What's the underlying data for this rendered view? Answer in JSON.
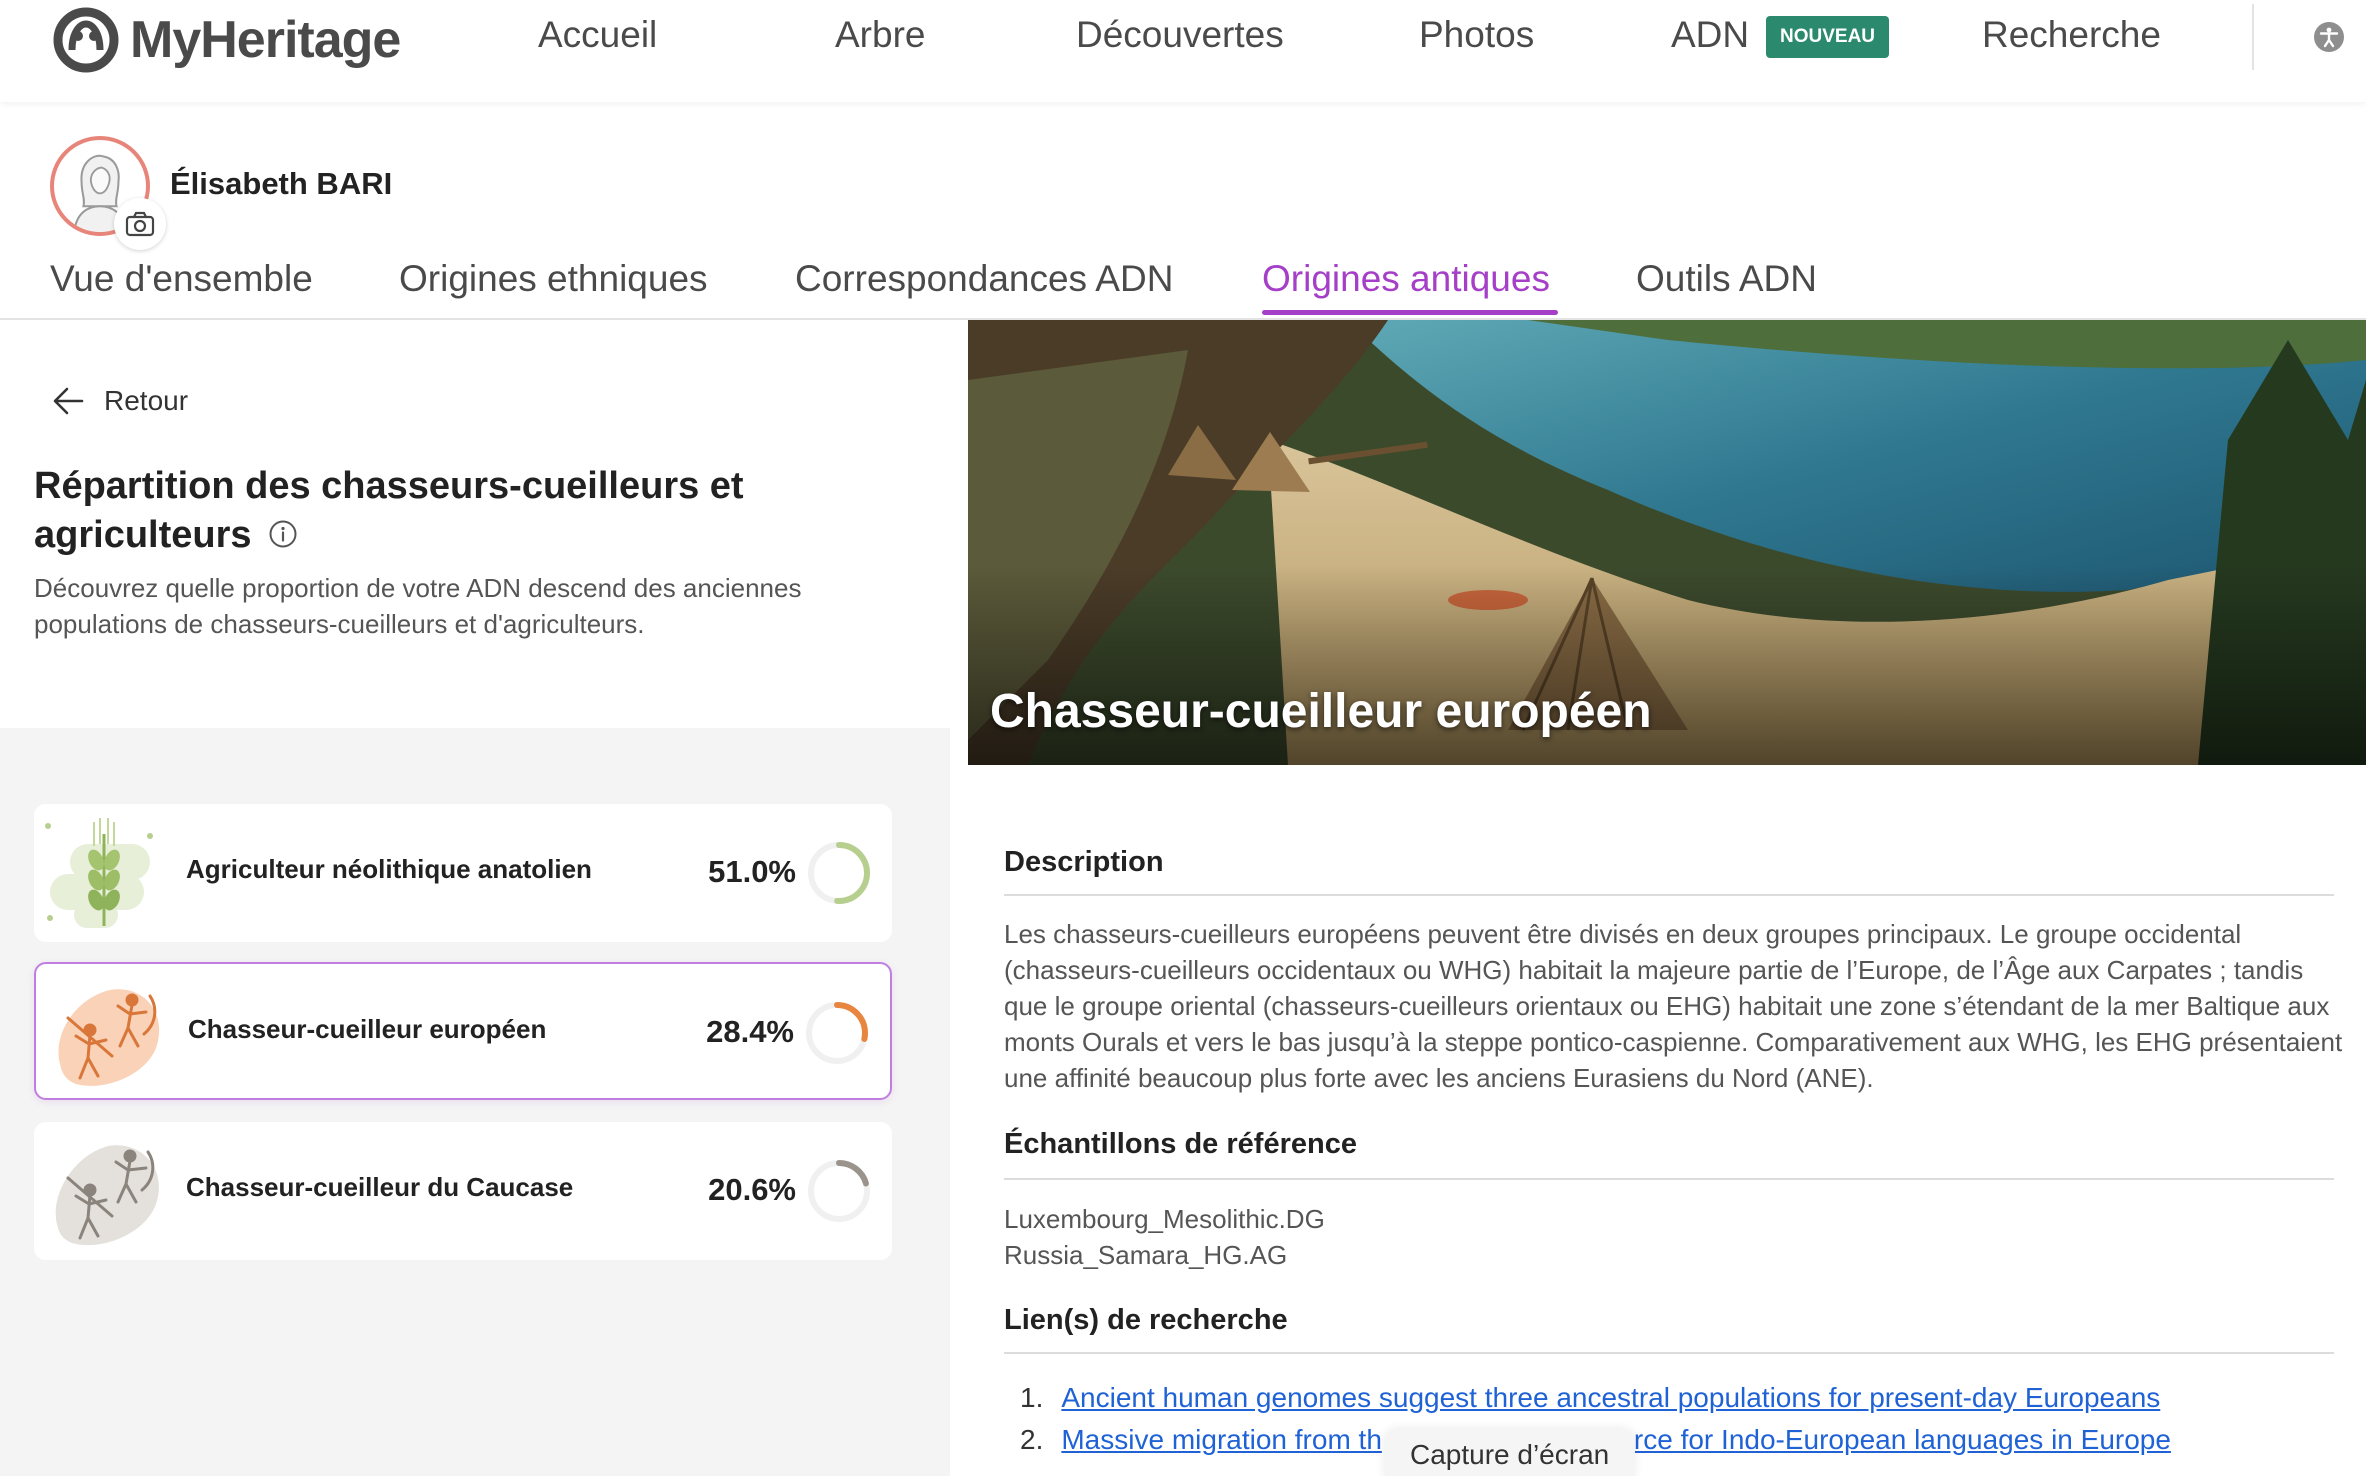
{
  "brand": {
    "name": "MyHeritage"
  },
  "nav": {
    "items": [
      "Accueil",
      "Arbre",
      "Découvertes",
      "Photos",
      "ADN",
      "Recherche"
    ],
    "adn_badge": "NOUVEAU"
  },
  "profile": {
    "name": "Élisabeth BARI"
  },
  "tabs": [
    "Vue d'ensemble",
    "Origines ethniques",
    "Correspondances ADN",
    "Origines antiques",
    "Outils ADN"
  ],
  "active_tab": "Origines antiques",
  "panel": {
    "back_label": "Retour",
    "title": "Répartition des chasseurs-cueilleurs et agriculteurs",
    "description": "Découvrez quelle proportion de votre ADN descend des anciennes populations de chasseurs-cueilleurs et d'agriculteurs.",
    "cards": [
      {
        "label": "Agriculteur néolithique anatolien",
        "percent": "51.0%",
        "value": 51.0,
        "color": "#b7cf8e"
      },
      {
        "label": "Chasseur-cueilleur européen",
        "percent": "28.4%",
        "value": 28.4,
        "color": "#e8863f"
      },
      {
        "label": "Chasseur-cueilleur du Caucase",
        "percent": "20.6%",
        "value": 20.6,
        "color": "#9a948c"
      }
    ]
  },
  "detail": {
    "hero_title": "Chasseur-cueilleur européen",
    "description_heading": "Description",
    "description": "Les chasseurs-cueilleurs européens peuvent être divisés en deux groupes principaux. Le groupe occidental (chasseurs-cueilleurs occidentaux ou WHG) habitait la majeure partie de l’Europe, de l’Âge aux Carpates ; tandis que le groupe oriental (chasseurs-cueilleurs orientaux ou EHG) habitait une zone s’étendant de la mer Baltique aux monts Ourals et vers le bas jusqu’à la steppe pontico-caspienne. Comparativement aux WHG, les EHG présentaient une affinité beaucoup plus forte avec les anciens Eurasiens du Nord (ANE).",
    "samples_heading": "Échantillons de référence",
    "samples": [
      "Luxembourg_Mesolithic.DG",
      "Russia_Samara_HG.AG"
    ],
    "links_heading": "Lien(s) de recherche",
    "links": [
      {
        "num": "1.",
        "text": "Ancient human genomes suggest three ancestral populations for present-day Europeans"
      },
      {
        "num": "2.",
        "text": "Massive migration from th",
        "text_end": "rce for Indo-European languages in Europe"
      }
    ]
  },
  "overlay": {
    "toast": "Capture d’écran"
  },
  "colors": {
    "accent": "#a53fc7",
    "badge": "#2b8a6e",
    "link": "#1f62d6"
  }
}
